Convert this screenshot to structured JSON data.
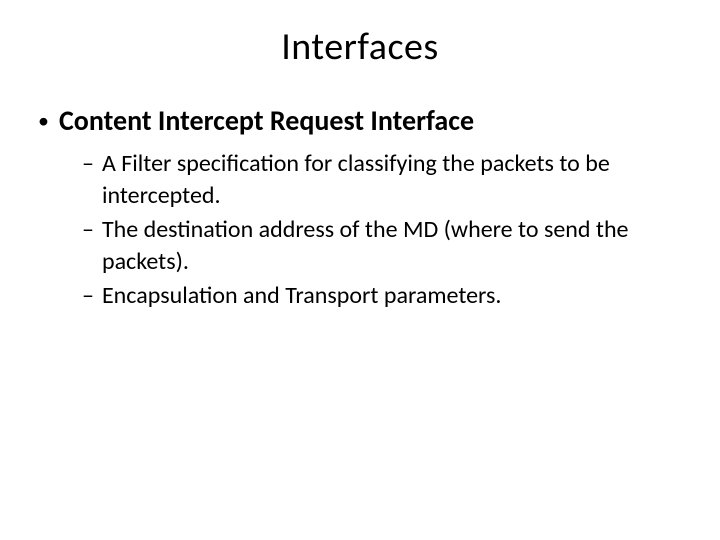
{
  "title": "Interfaces",
  "main_bullet": "Content Intercept Request Interface",
  "sub_bullets": [
    "A Filter specification for classifying the packets to be intercepted.",
    "The destination address of the MD (where to send the packets).",
    "Encapsulation and Transport parameters."
  ],
  "markers": {
    "dot": "•",
    "dash": "–"
  }
}
